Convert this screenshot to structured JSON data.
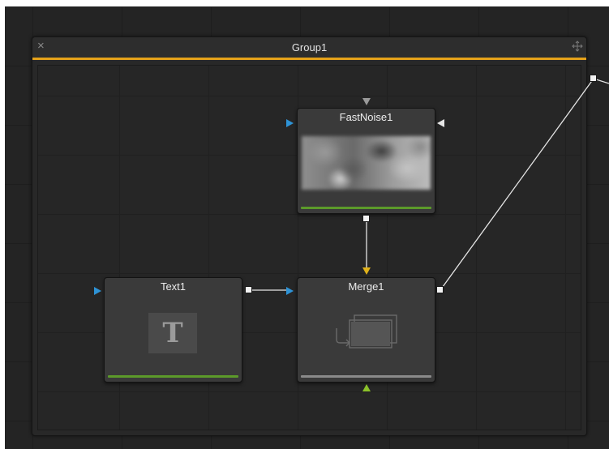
{
  "group": {
    "title": "Group1",
    "close_glyph": "×",
    "header_color": "#e5a21a"
  },
  "nodes": {
    "fastnoise": {
      "title": "FastNoise1",
      "status_color": "#5c9a2a"
    },
    "text": {
      "title": "Text1",
      "icon_glyph": "T",
      "status_color": "#5c9a2a"
    },
    "merge": {
      "title": "Merge1",
      "status_color": "#8a8a8a"
    }
  },
  "ports": {
    "input_color": "#2e93d6",
    "bg_input_color": "#e0b21a",
    "mask_input_color": "#8bc12a",
    "effect_mask_color": "#cfcfcf"
  }
}
